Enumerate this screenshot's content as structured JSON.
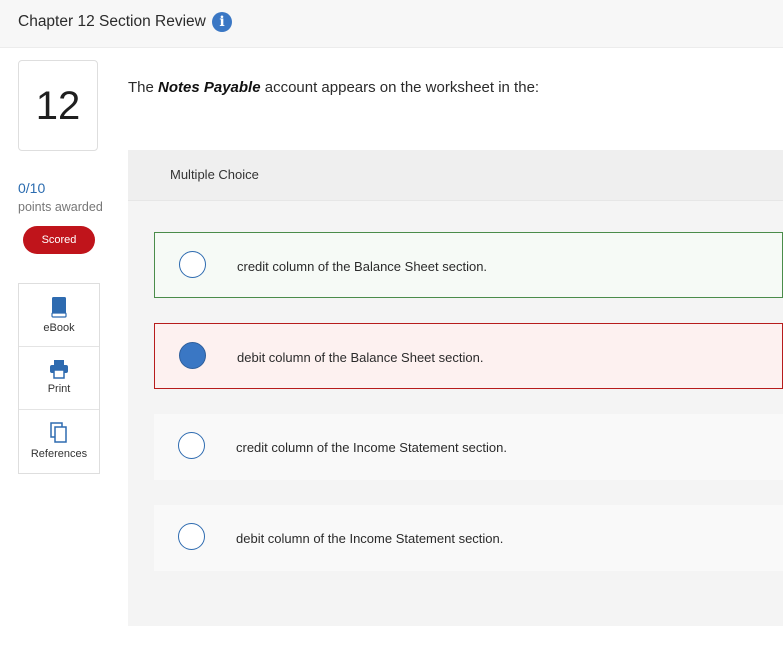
{
  "header": {
    "title": "Chapter 12 Section Review",
    "info_icon": "info-icon"
  },
  "sidebar": {
    "question_number": "12",
    "points": "0/10",
    "points_label": "points awarded",
    "status_badge": "Scored",
    "tools": [
      {
        "label": "eBook",
        "icon": "book-icon"
      },
      {
        "label": "Print",
        "icon": "printer-icon"
      },
      {
        "label": "References",
        "icon": "copy-icon"
      }
    ]
  },
  "question": {
    "prefix": "The ",
    "emphasis": "Notes Payable",
    "suffix": " account appears on the worksheet in the:"
  },
  "mc": {
    "title": "Multiple Choice",
    "options": [
      {
        "text": "credit column of the Balance Sheet section.",
        "state": "correct",
        "selected": false
      },
      {
        "text": "debit column of the Balance Sheet section.",
        "state": "incorrect",
        "selected": true
      },
      {
        "text": "credit column of the Income Statement section.",
        "state": "neutral",
        "selected": false
      },
      {
        "text": "debit column of the Income Statement section.",
        "state": "neutral",
        "selected": false
      }
    ]
  },
  "colors": {
    "accent": "#3a77c4",
    "scored": "#c0141b",
    "correct_border": "#4a8c4a",
    "incorrect_border": "#b71c1c"
  }
}
